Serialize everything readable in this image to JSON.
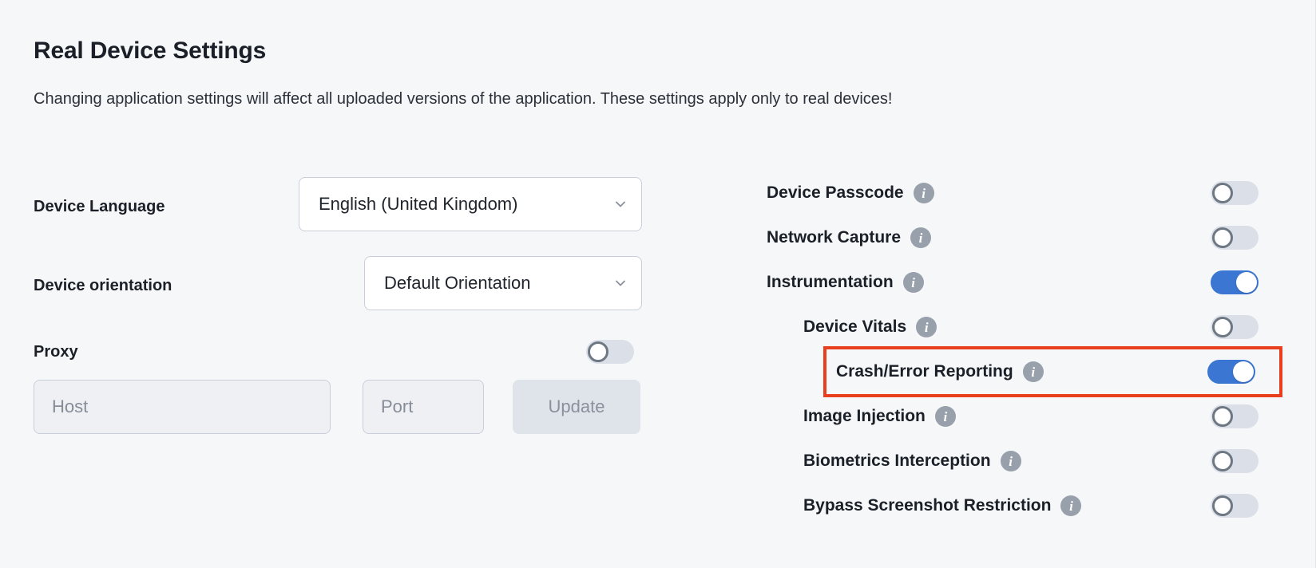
{
  "header": {
    "title": "Real Device Settings",
    "subtitle": "Changing application settings will affect all uploaded versions of the application. These settings apply only to real devices!"
  },
  "left": {
    "device_language": {
      "label": "Device Language",
      "value": "English (United Kingdom)",
      "chevron": "chevron-down-icon"
    },
    "device_orientation": {
      "label": "Device orientation",
      "value": "Default Orientation",
      "chevron": "chevron-down-icon"
    },
    "proxy": {
      "label": "Proxy",
      "enabled": false,
      "host_placeholder": "Host",
      "host_value": "",
      "port_placeholder": "Port",
      "port_value": "",
      "update_label": "Update"
    }
  },
  "right": {
    "info_glyph": "i",
    "items": [
      {
        "label": "Device Passcode",
        "enabled": false,
        "indent": 1,
        "highlighted": false
      },
      {
        "label": "Network Capture",
        "enabled": false,
        "indent": 1,
        "highlighted": false
      },
      {
        "label": "Instrumentation",
        "enabled": true,
        "indent": 1,
        "highlighted": false
      },
      {
        "label": "Device Vitals",
        "enabled": false,
        "indent": 2,
        "highlighted": false
      },
      {
        "label": "Crash/Error Reporting",
        "enabled": true,
        "indent": 2,
        "highlighted": true
      },
      {
        "label": "Image Injection",
        "enabled": false,
        "indent": 2,
        "highlighted": false
      },
      {
        "label": "Biometrics Interception",
        "enabled": false,
        "indent": 2,
        "highlighted": false
      },
      {
        "label": "Bypass Screenshot Restriction",
        "enabled": false,
        "indent": 2,
        "highlighted": false
      }
    ]
  },
  "colors": {
    "background": "#f6f7f9",
    "toggle_on": "#3b77d2",
    "toggle_off": "#dbe0e8",
    "highlight_outline": "#e8401f",
    "text": "#1b2028",
    "info_badge": "#98a0ab"
  }
}
